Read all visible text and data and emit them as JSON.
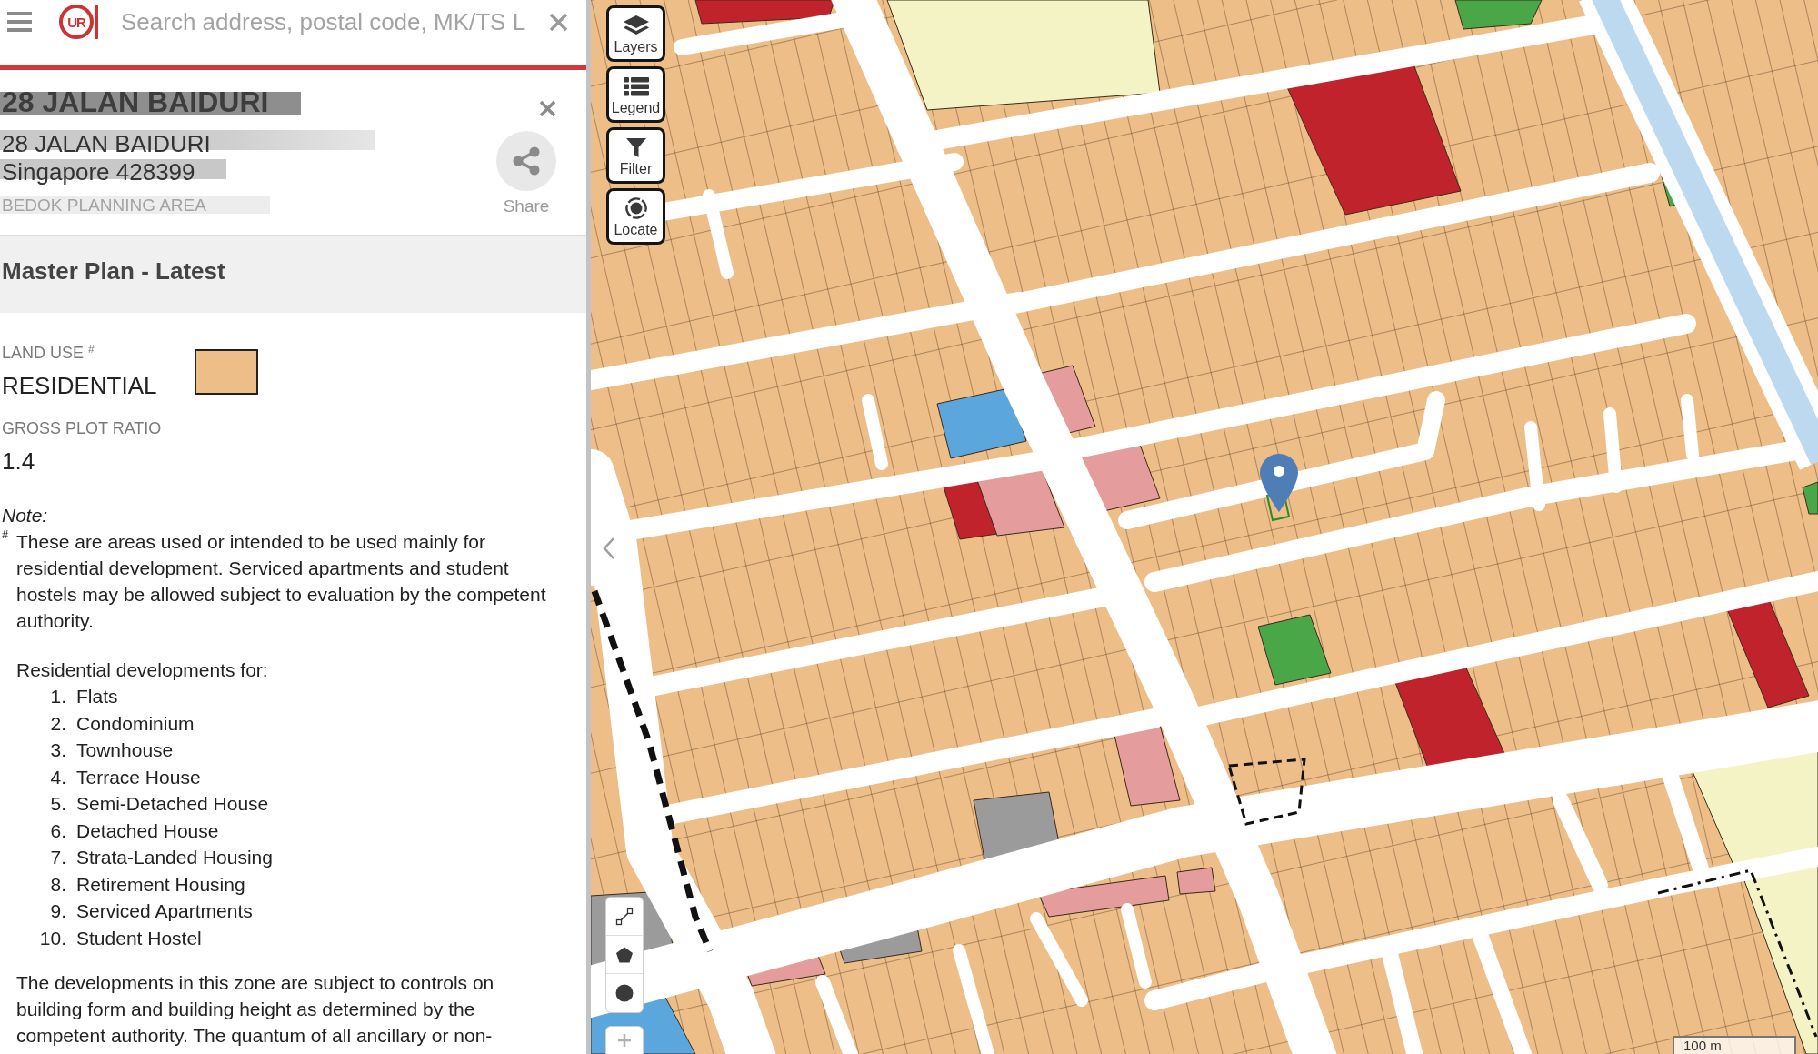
{
  "header": {
    "logo_text": "UR",
    "search": {
      "placeholder": "Search address, postal code, MK/TS L"
    }
  },
  "result": {
    "title": "28 JALAN BAIDURI",
    "address_lines": [
      "28 JALAN BAIDURI",
      "Singapore 428399"
    ],
    "planning_area": "BEDOK PLANNING AREA",
    "share_label": "Share"
  },
  "section": {
    "title": "Master Plan - Latest"
  },
  "fields": [
    {
      "kind": "land_use",
      "label": "LAND USE $^{#}$",
      "value": "RESIDENTIAL",
      "color": "#edbe88"
    },
    {
      "kind": "plain",
      "label": "GROSS PLOT RATIO",
      "value": "1.4"
    }
  ],
  "note": {
    "heading": "Note:",
    "mark": "#",
    "text": "These are areas used or intended to be used mainly for residential development. Serviced apartments and student hostels may be allowed subject to evaluation by the competent authority.",
    "list_intro": "Residential developments for:",
    "items": [
      {
        "number": "1.",
        "text": "Flats"
      },
      {
        "number": "2.",
        "text": "Condominium"
      },
      {
        "number": "3.",
        "text": "Townhouse"
      },
      {
        "number": "4.",
        "text": "Terrace House"
      },
      {
        "number": "5.",
        "text": "Semi-Detached House"
      },
      {
        "number": "6.",
        "text": "Detached House"
      },
      {
        "number": "7.",
        "text": "Strata-Landed Housing"
      },
      {
        "number": "8.",
        "text": "Retirement Housing"
      },
      {
        "number": "9.",
        "text": "Serviced Apartments"
      },
      {
        "number": "10.",
        "text": "Student Hostel"
      }
    ],
    "closing": "The developments in this zone are subject to controls on building form and building height as determined by the competent authority. The quantum of all ancillary or non-"
  },
  "map": {
    "controls": [
      {
        "kind": "layers",
        "label": "Layers"
      },
      {
        "kind": "legend",
        "label": "Legend"
      },
      {
        "kind": "filter",
        "label": "Filter"
      },
      {
        "kind": "locate",
        "label": "Locate"
      }
    ],
    "draw_tools": [
      {
        "kind": "line"
      },
      {
        "kind": "polygon"
      },
      {
        "kind": "circle"
      }
    ],
    "scale_label": "100 m"
  }
}
